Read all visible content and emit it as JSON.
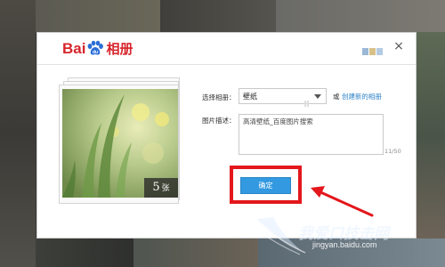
{
  "header": {
    "logo_bai": "Bai",
    "logo_du": "du",
    "logo_album": "相册",
    "close_symbol": "×"
  },
  "preview": {
    "count_number": "5",
    "count_unit": "张"
  },
  "form": {
    "album_label": "选择相册：",
    "album_value": "壁纸",
    "or_text": "或",
    "create_link": "创建新的相册",
    "desc_label": "图片描述：",
    "desc_value": "高清壁纸_百度图片搜索",
    "char_counter": "11/50"
  },
  "actions": {
    "confirm_label": "确定"
  },
  "watermark": {
    "text": "我爱口技击网",
    "url": "jingyan.baidu.com"
  },
  "colors": {
    "brand_red": "#d7252c",
    "brand_blue": "#2b6fd6",
    "link_blue": "#2f83c8",
    "button_blue": "#3399e0",
    "highlight_red": "#e3171c"
  },
  "icons": [
    "paw-icon",
    "skin-icon",
    "close-icon",
    "dropdown-caret-icon",
    "arrow-annotation",
    "wing-icon"
  ]
}
